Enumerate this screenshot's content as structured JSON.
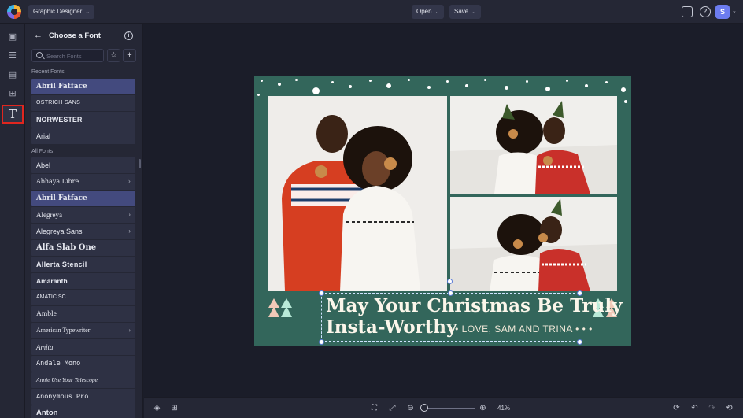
{
  "app": {
    "workspace": "Graphic Designer"
  },
  "top_menu": {
    "open_label": "Open",
    "save_label": "Save"
  },
  "user": {
    "initial": "S"
  },
  "panel": {
    "title": "Choose a Font",
    "search_placeholder": "Search Fonts",
    "recent_label": "Recent Fonts",
    "all_label": "All Fonts",
    "recent_fonts": [
      "Abril Fatface",
      "OSTRICH SANS",
      "NORWESTER",
      "Arial"
    ],
    "all_fonts": [
      {
        "name": "Abel",
        "has_variants": false
      },
      {
        "name": "Abhaya Libre",
        "has_variants": true
      },
      {
        "name": "Abril Fatface",
        "has_variants": false,
        "selected": true
      },
      {
        "name": "Alegreya",
        "has_variants": true
      },
      {
        "name": "Alegreya Sans",
        "has_variants": true
      },
      {
        "name": "Alfa Slab One",
        "has_variants": false
      },
      {
        "name": "Allerta Stencil",
        "has_variants": false
      },
      {
        "name": "Amaranth",
        "has_variants": false
      },
      {
        "name": "AMATIC SC",
        "has_variants": false
      },
      {
        "name": "Amble",
        "has_variants": false
      },
      {
        "name": "American Typewriter",
        "has_variants": true
      },
      {
        "name": "Amita",
        "has_variants": false
      },
      {
        "name": "Andale Mono",
        "has_variants": false
      },
      {
        "name": "Annie Use Your Telescope",
        "has_variants": false
      },
      {
        "name": "Anonymous Pro",
        "has_variants": false
      },
      {
        "name": "Anton",
        "has_variants": false
      }
    ]
  },
  "design": {
    "headline_line1": "May Your Christmas Be Truly",
    "headline_line2": "Insta-Worthy",
    "signoff": "• • • LOVE, SAM AND TRINA • • •",
    "background_color": "#33665b"
  },
  "bottom_bar": {
    "zoom_percent": "41%"
  },
  "colors": {
    "accent": "#434a7e",
    "highlight_border": "#e0261f"
  }
}
